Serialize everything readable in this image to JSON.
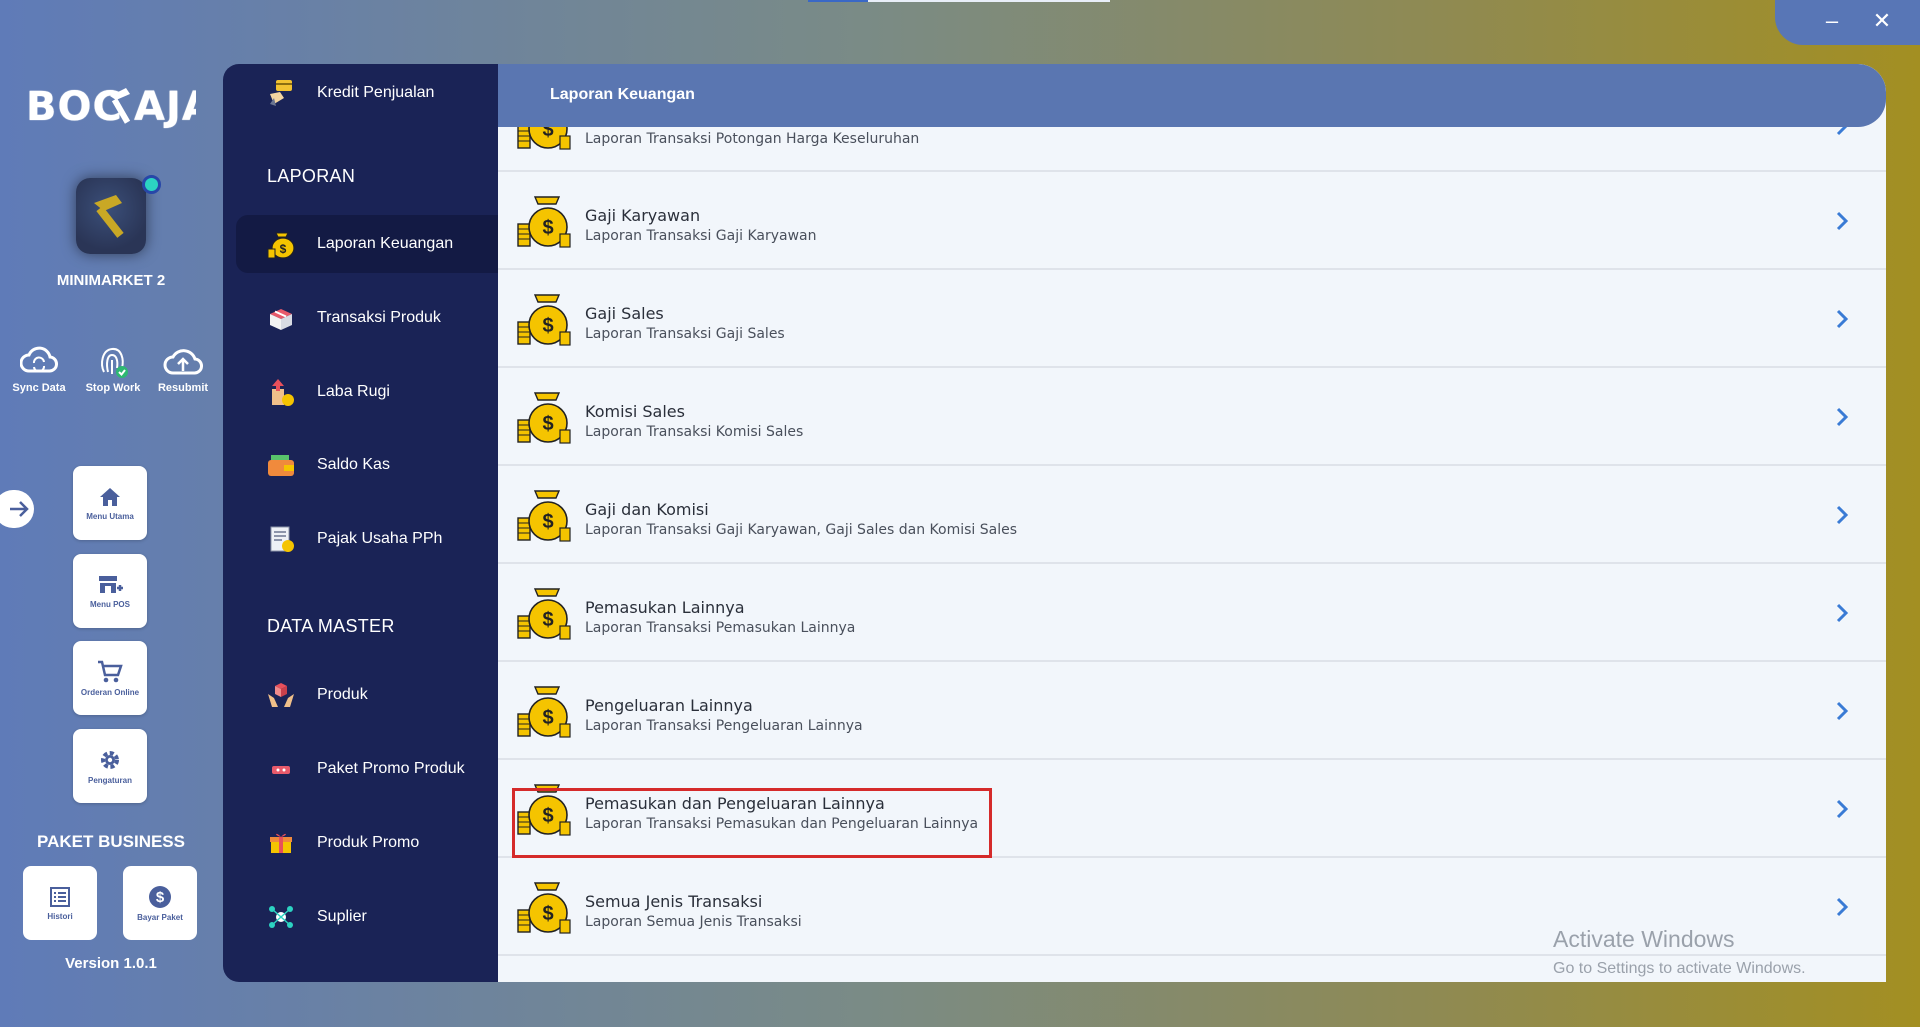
{
  "window": {
    "minimize_label": "–",
    "close_label": "✕"
  },
  "brand": {
    "logo_text": "BOCSAJA"
  },
  "store": {
    "name": "MINIMARKET 2"
  },
  "quick_actions": [
    {
      "label": "Sync Data",
      "icon": "sync-icon"
    },
    {
      "label": "Stop Work",
      "icon": "fingerprint-icon"
    },
    {
      "label": "Resubmit",
      "icon": "cloud-upload-icon"
    }
  ],
  "nav_tiles": [
    {
      "label": "Menu Utama",
      "icon": "home-icon"
    },
    {
      "label": "Menu POS",
      "icon": "store-icon"
    },
    {
      "label": "Orderan Online",
      "icon": "cart-icon"
    },
    {
      "label": "Pengaturan",
      "icon": "gear-icon"
    }
  ],
  "paket": {
    "title": "PAKET BUSINESS",
    "tiles": [
      {
        "label": "Histori",
        "icon": "list-icon"
      },
      {
        "label": "Bayar Paket",
        "icon": "dollar-icon"
      }
    ]
  },
  "version": "Version 1.0.1",
  "sidebar": {
    "top_item": "Kredit Penjualan",
    "section_laporan": "LAPORAN",
    "laporan_items": [
      "Laporan Keuangan",
      "Transaksi Produk",
      "Laba Rugi",
      "Saldo Kas",
      "Pajak Usaha PPh"
    ],
    "section_master": "DATA MASTER",
    "master_items": [
      "Produk",
      "Paket Promo Produk",
      "Produk Promo",
      "Suplier"
    ]
  },
  "main": {
    "title": "Laporan Keuangan",
    "rows": [
      {
        "title": "",
        "subtitle": "Laporan Transaksi Potongan Harga Keseluruhan"
      },
      {
        "title": "Gaji Karyawan",
        "subtitle": "Laporan Transaksi Gaji Karyawan"
      },
      {
        "title": "Gaji Sales",
        "subtitle": "Laporan Transaksi Gaji Sales"
      },
      {
        "title": "Komisi Sales",
        "subtitle": "Laporan Transaksi Komisi Sales"
      },
      {
        "title": "Gaji dan Komisi",
        "subtitle": "Laporan Transaksi Gaji Karyawan, Gaji Sales dan Komisi Sales"
      },
      {
        "title": "Pemasukan Lainnya",
        "subtitle": "Laporan Transaksi Pemasukan Lainnya"
      },
      {
        "title": "Pengeluaran Lainnya",
        "subtitle": "Laporan Transaksi Pengeluaran Lainnya"
      },
      {
        "title": "Pemasukan dan Pengeluaran Lainnya",
        "subtitle": "Laporan Transaksi Pemasukan dan Pengeluaran Lainnya"
      },
      {
        "title": "Semua Jenis Transaksi",
        "subtitle": "Laporan Semua Jenis Transaksi"
      }
    ]
  },
  "watermark": {
    "line1": "Activate Windows",
    "line2": "Go to Settings to activate Windows."
  },
  "colors": {
    "sidebar": "#1a2356",
    "header": "#5a76b1",
    "highlight": "#d52a2a",
    "coin": "#f5c400"
  }
}
